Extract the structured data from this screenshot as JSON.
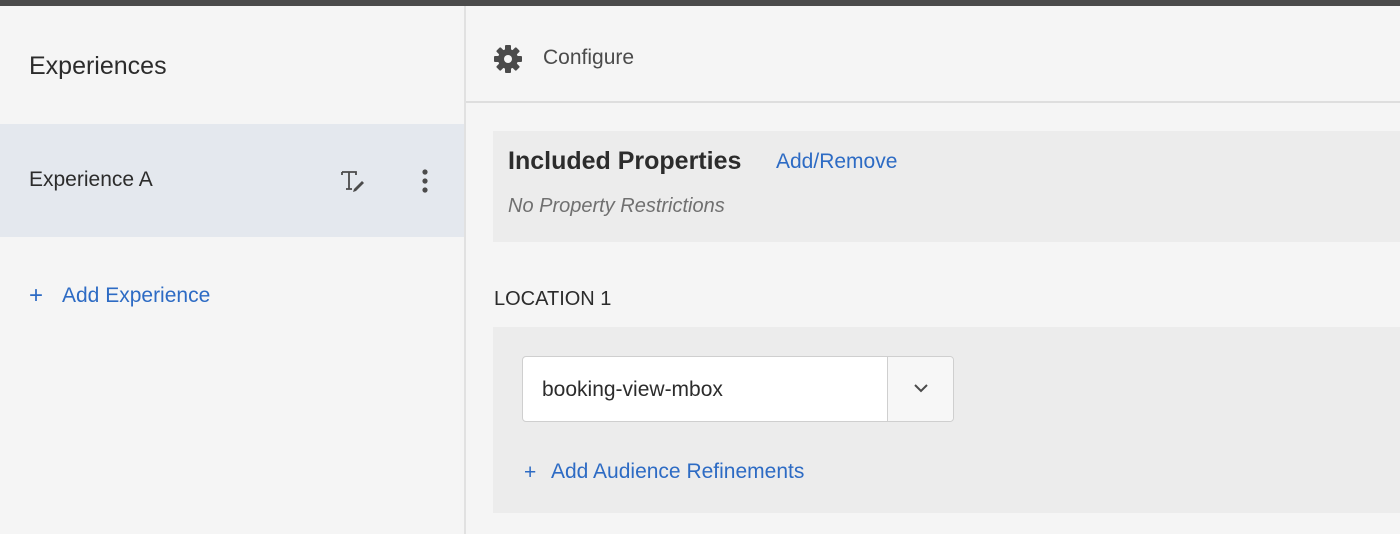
{
  "sidebar": {
    "title": "Experiences",
    "experiences": [
      {
        "label": "Experience A",
        "selected": true
      }
    ],
    "add_experience_label": "Add Experience"
  },
  "header": {
    "configure_label": "Configure"
  },
  "included_properties": {
    "title": "Included Properties",
    "action_label": "Add/Remove",
    "note": "No Property Restrictions"
  },
  "location": {
    "label": "LOCATION 1",
    "mbox_value": "booking-view-mbox",
    "add_refinements_label": "Add Audience Refinements"
  },
  "icons": {
    "rename": "rename-text-icon",
    "more": "more-vertical-icon",
    "gear": "gear-icon",
    "chevron": "chevron-down-icon",
    "plus": "plus-icon"
  },
  "colors": {
    "link": "#2d6bc4",
    "selected_bg": "#e4e8ee",
    "topbar": "#4b4b4b"
  }
}
